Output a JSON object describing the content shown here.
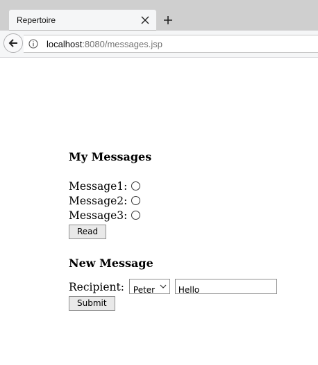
{
  "browser": {
    "tab_title": "Repertoire",
    "url_host": "localhost",
    "url_rest": ":8080/messages.jsp",
    "icons": {
      "tab_close": "close-icon",
      "new_tab": "plus-icon",
      "back": "back-arrow-icon",
      "site_info": "info-icon"
    }
  },
  "page": {
    "my_messages_heading": "My Messages",
    "messages": [
      {
        "label": "Message1:",
        "selected": false
      },
      {
        "label": "Message2:",
        "selected": false
      },
      {
        "label": "Message3:",
        "selected": false
      }
    ],
    "read_button": "Read",
    "new_message_heading": "New Message",
    "recipient_label": "Recipient:",
    "recipient_selected": "Peter",
    "message_text": "Hello",
    "submit_button": "Submit"
  }
}
